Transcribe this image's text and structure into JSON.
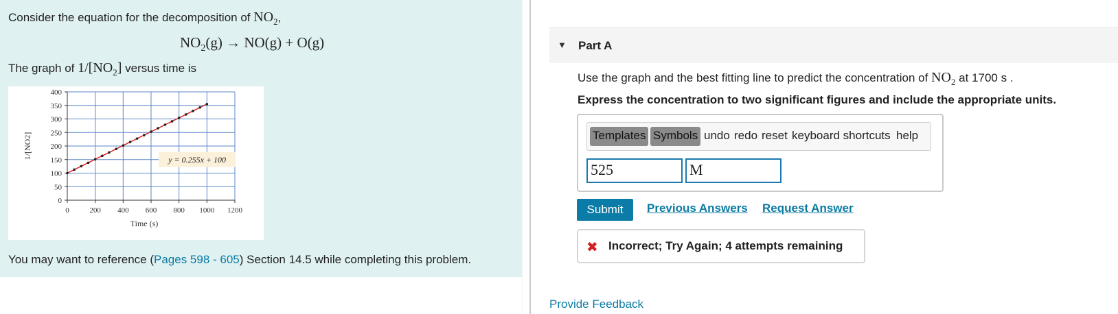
{
  "problem": {
    "intro_text": "Consider the equation for the decomposition of ",
    "intro_formula": "NO2",
    "intro_suffix": ",",
    "equation": "NO2(g) → NO(g) + O(g)",
    "graph_prefix": "The graph of ",
    "graph_quantity": "1/[NO2]",
    "graph_suffix": " versus time is",
    "reference_prefix": "You may want to reference (",
    "reference_link": "Pages 598 - 605",
    "reference_suffix": ") Section 14.5 while completing this problem."
  },
  "chart_data": {
    "type": "line",
    "xlabel": "Time (s)",
    "ylabel": "1/[NO2]",
    "xlim": [
      0,
      1200
    ],
    "ylim": [
      0,
      400
    ],
    "x_ticks": [
      "0",
      "200",
      "400",
      "600",
      "800",
      "1000",
      "1200"
    ],
    "y_ticks": [
      "0",
      "50",
      "100",
      "150",
      "200",
      "250",
      "300",
      "350",
      "400"
    ],
    "grid": true,
    "annotation": "y = 0.255x + 100",
    "series": [
      {
        "x": [
          0,
          50,
          100,
          150,
          200,
          250,
          300,
          350,
          400,
          450,
          500,
          550,
          600,
          650,
          700,
          750,
          800,
          850,
          900,
          950,
          1000
        ],
        "y": [
          100,
          112.75,
          125.5,
          138.25,
          151,
          163.75,
          176.5,
          189.25,
          202,
          214.75,
          227.5,
          240.25,
          253,
          265.75,
          278.5,
          291.25,
          304,
          316.75,
          329.5,
          342.25,
          355
        ],
        "line_color": "#e02020",
        "marker_color": "#222222"
      }
    ]
  },
  "part": {
    "label": "Part A",
    "question_prefix": "Use the graph and the best fitting line to predict the concentration of ",
    "question_formula": "NO2",
    "question_suffix": " at 1700 s .",
    "instruction": "Express the concentration to two significant figures and include the appropriate units."
  },
  "toolbar": {
    "templates": "Templates",
    "symbols": "Symbols",
    "undo": "undo",
    "redo": "redo",
    "reset": "reset",
    "shortcuts": "keyboard shortcuts",
    "help": "help"
  },
  "answer": {
    "value": "525",
    "units": "M"
  },
  "actions": {
    "submit": "Submit",
    "previous_answers": "Previous Answers",
    "request_answer": "Request Answer"
  },
  "feedback": {
    "message": "Incorrect; Try Again; 4 attempts remaining"
  },
  "footer": {
    "provide_feedback": "Provide Feedback"
  },
  "colors": {
    "accent": "#0b7ba7",
    "link": "#0a7ba3",
    "error": "#d0201f",
    "panel_bg": "#e0f1f2"
  }
}
